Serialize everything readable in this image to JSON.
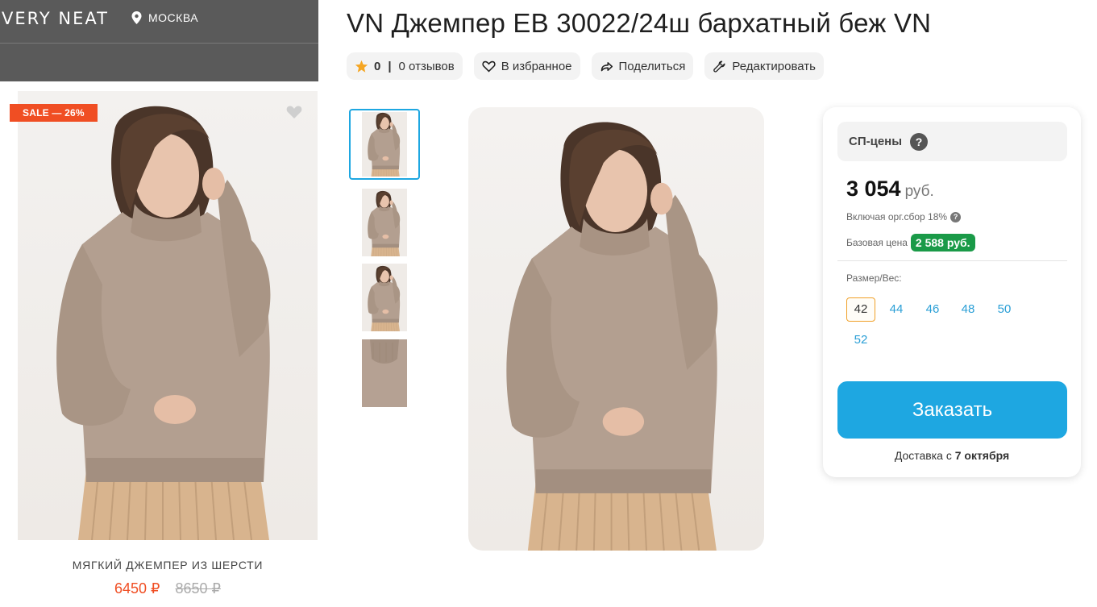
{
  "store": {
    "brand": "VERY NEAT",
    "city": "МОСКВА",
    "card": {
      "sale_badge": "SALE — 26%",
      "title": "МЯГКИЙ ДЖЕМПЕР ИЗ ШЕРСТИ",
      "price_new": "6450 ₽",
      "price_old": "8650 ₽"
    }
  },
  "product": {
    "title": "VN Джемпер ЕВ 30022/24ш бархатный беж VN",
    "rating": "0",
    "rating_sep": "|",
    "reviews": "0 отзывов",
    "favorite_label": "В избранное",
    "share_label": "Поделиться",
    "edit_label": "Редактировать"
  },
  "price_panel": {
    "sp_label": "СП-цены",
    "sp_help": "?",
    "price": "3 054",
    "currency": "руб.",
    "org_fee": "Включая орг.сбор 18%",
    "org_fee_help": "?",
    "base_label": "Базовая цена",
    "base_price": "2 588 руб.",
    "size_label": "Размер/Вес:",
    "sizes": [
      "42",
      "44",
      "46",
      "48",
      "50",
      "52"
    ],
    "selected_size": "42",
    "order_label": "Заказать",
    "delivery_prefix": "Доставка с",
    "delivery_date": "7 октября"
  },
  "colors": {
    "accent": "#1ea7e1",
    "sale": "#f04e23",
    "base_price_badge": "#1a9a48",
    "selected_size_border": "#f0a028",
    "header_bg": "#5a5a5a",
    "sweater": "#b39f90",
    "skirt": "#d8b48e"
  },
  "icons": {
    "location": "map-pin-icon",
    "heart": "heart-icon",
    "star": "star-icon",
    "share": "share-arrow-icon",
    "edit": "wrench-icon"
  }
}
